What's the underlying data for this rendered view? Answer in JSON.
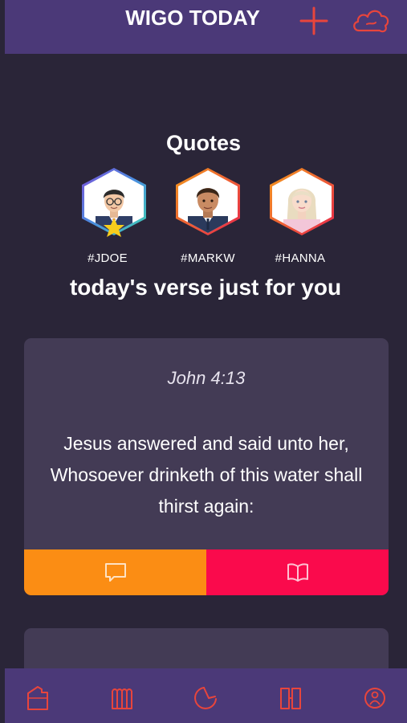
{
  "header": {
    "title": "WIGO TODAY",
    "icons": [
      "add-icon",
      "cloud-icon"
    ]
  },
  "quotes": {
    "title": "Quotes",
    "users": [
      {
        "tag": "#JDOE",
        "featured": true
      },
      {
        "tag": "#MARKW",
        "featured": false
      },
      {
        "tag": "#HANNA",
        "featured": false
      }
    ]
  },
  "verse_heading": "today's verse just for you",
  "verse_card": {
    "reference": "John 4:13",
    "text": "Jesus answered and said unto her, Whosoever drinketh of this water shall thirst again:",
    "actions": [
      "comment-icon",
      "open-book-icon"
    ]
  },
  "bottom_nav": {
    "items": [
      "home-icon",
      "library-icon",
      "timer-icon",
      "bible-icon",
      "profile-icon"
    ]
  },
  "colors": {
    "background": "#2a2538",
    "bar": "#4b3978",
    "card": "#433b55",
    "accent_orange": "#fb8d14",
    "accent_pink": "#fa0a4c",
    "icon_red": "#e8453c"
  }
}
